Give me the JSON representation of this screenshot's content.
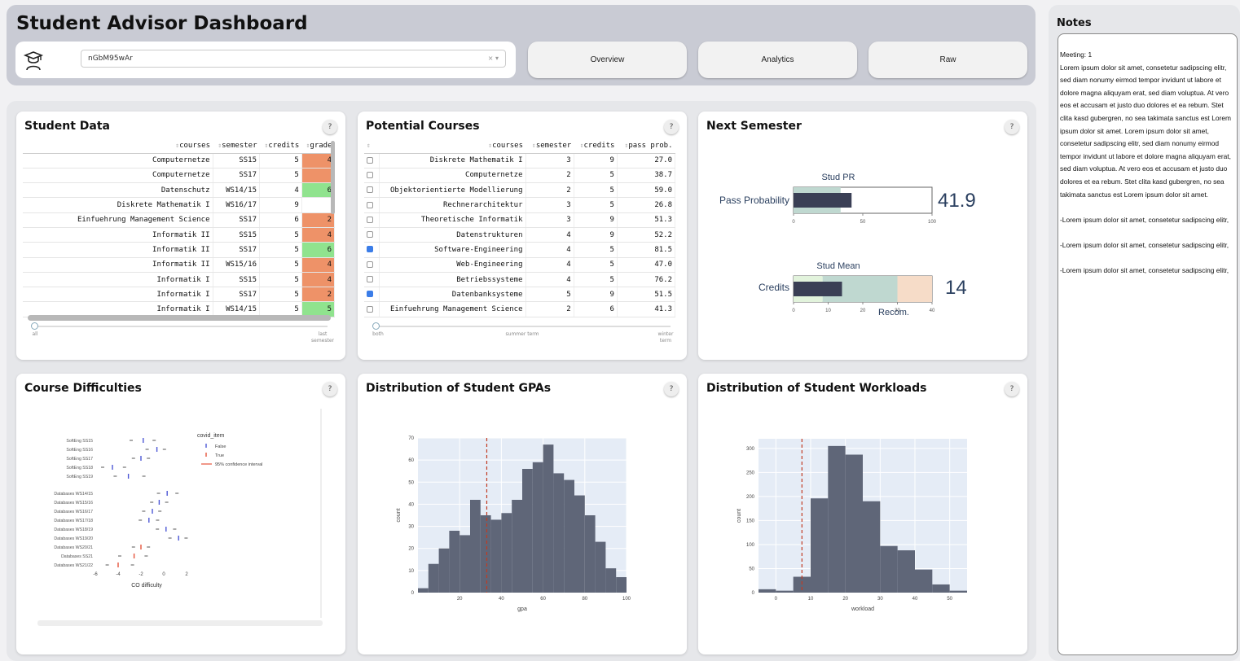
{
  "header": {
    "title": "Student Advisor Dashboard",
    "student_id": "nGbM95wAr",
    "clear_symbol": "×",
    "dropdown_symbol": "▾",
    "nav": [
      "Overview",
      "Analytics",
      "Raw"
    ]
  },
  "help_label": "?",
  "student_data": {
    "title": "Student Data",
    "columns": [
      "courses",
      "semester",
      "credits",
      "grade"
    ],
    "rows": [
      {
        "course": "Computernetze",
        "semester": "SS15",
        "credits": "5",
        "grade": "4",
        "grade_color": "red"
      },
      {
        "course": "Computernetze",
        "semester": "SS17",
        "credits": "5",
        "grade": "",
        "grade_color": "red"
      },
      {
        "course": "Datenschutz",
        "semester": "WS14/15",
        "credits": "4",
        "grade": "6",
        "grade_color": "green"
      },
      {
        "course": "Diskrete Mathematik I",
        "semester": "WS16/17",
        "credits": "9",
        "grade": "",
        "grade_color": "none"
      },
      {
        "course": "Einfuehrung Management Science",
        "semester": "SS17",
        "credits": "6",
        "grade": "2",
        "grade_color": "red"
      },
      {
        "course": "Informatik II",
        "semester": "SS15",
        "credits": "5",
        "grade": "4",
        "grade_color": "red"
      },
      {
        "course": "Informatik II",
        "semester": "SS17",
        "credits": "5",
        "grade": "6",
        "grade_color": "green"
      },
      {
        "course": "Informatik II",
        "semester": "WS15/16",
        "credits": "5",
        "grade": "4",
        "grade_color": "red"
      },
      {
        "course": "Informatik I",
        "semester": "SS15",
        "credits": "5",
        "grade": "4",
        "grade_color": "red"
      },
      {
        "course": "Informatik I",
        "semester": "SS17",
        "credits": "5",
        "grade": "2",
        "grade_color": "red"
      },
      {
        "course": "Informatik I",
        "semester": "WS14/15",
        "credits": "5",
        "grade": "5",
        "grade_color": "green"
      }
    ],
    "slider_labels": {
      "left": "all",
      "right": "last semester"
    }
  },
  "potential_courses": {
    "title": "Potential Courses",
    "columns": [
      "courses",
      "semester",
      "credits",
      "pass prob."
    ],
    "rows": [
      {
        "checked": false,
        "course": "Diskrete Mathematik I",
        "semester": "3",
        "credits": "9",
        "prob": "27.0"
      },
      {
        "checked": false,
        "course": "Computernetze",
        "semester": "2",
        "credits": "5",
        "prob": "38.7"
      },
      {
        "checked": false,
        "course": "Objektorientierte Modellierung",
        "semester": "2",
        "credits": "5",
        "prob": "59.0"
      },
      {
        "checked": false,
        "course": "Rechnerarchitektur",
        "semester": "3",
        "credits": "5",
        "prob": "26.8"
      },
      {
        "checked": false,
        "course": "Theoretische Informatik",
        "semester": "3",
        "credits": "9",
        "prob": "51.3"
      },
      {
        "checked": false,
        "course": "Datenstrukturen",
        "semester": "4",
        "credits": "9",
        "prob": "52.2"
      },
      {
        "checked": true,
        "course": "Software-Engineering",
        "semester": "4",
        "credits": "5",
        "prob": "81.5"
      },
      {
        "checked": false,
        "course": "Web-Engineering",
        "semester": "4",
        "credits": "5",
        "prob": "47.0"
      },
      {
        "checked": false,
        "course": "Betriebssysteme",
        "semester": "4",
        "credits": "5",
        "prob": "76.2"
      },
      {
        "checked": true,
        "course": "Datenbanksysteme",
        "semester": "5",
        "credits": "9",
        "prob": "51.5"
      },
      {
        "checked": false,
        "course": "Einfuehrung Management Science",
        "semester": "2",
        "credits": "6",
        "prob": "41.3"
      }
    ],
    "slider_labels": {
      "left": "both",
      "middle": "summer term",
      "right": "winter term"
    }
  },
  "next_semester": {
    "title": "Next Semester",
    "gauges": [
      {
        "label": "Pass Probability",
        "value_text": "41.9",
        "value": 41.9,
        "reference_label": "Stud PR",
        "range": [
          0,
          100
        ],
        "ticks": [
          "0",
          "50",
          "100"
        ],
        "band": 34,
        "extra_label": ""
      },
      {
        "label": "Credits",
        "value_text": "14",
        "value": 14,
        "reference_label": "Stud Mean",
        "range": [
          0,
          40
        ],
        "ticks": [
          "0",
          "10",
          "20",
          "30",
          "40"
        ],
        "band": 30,
        "extra_label": "Recom."
      }
    ]
  },
  "colors": {
    "red": "#ee9268",
    "green": "#90e38e",
    "bar": "#5f6678",
    "plot_bg": "#e5ecf6",
    "vline": "#c23b22",
    "gauge_bar": "#3a3f55",
    "gauge_band": "#bfd8d0",
    "gauge_peach": "#f6dcc8",
    "gauge_light": "#e2f3dc"
  },
  "charts": {
    "difficulties": {
      "title": "Course Difficulties"
    },
    "gpa": {
      "title": "Distribution of Student GPAs"
    },
    "workload": {
      "title": "Distribution of Student Workloads"
    }
  },
  "notes": {
    "title": "Notes",
    "text": "Meeting: 1\nLorem ipsum dolor sit amet, consetetur sadipscing elitr, sed diam nonumy eirmod tempor invidunt ut labore et dolore magna aliquyam erat, sed diam voluptua. At vero eos et accusam et justo duo dolores et ea rebum. Stet clita kasd gubergren, no sea takimata sanctus est Lorem ipsum dolor sit amet. Lorem ipsum dolor sit amet, consetetur sadipscing elitr, sed diam nonumy eirmod tempor invidunt ut labore et dolore magna aliquyam erat, sed diam voluptua. At vero eos et accusam et justo duo dolores et ea rebum. Stet clita kasd gubergren, no sea takimata sanctus est Lorem ipsum dolor sit amet.\n\n-Lorem ipsum dolor sit amet, consetetur sadipscing elitr,\n\n-Lorem ipsum dolor sit amet, consetetur sadipscing elitr,\n\n-Lorem ipsum dolor sit amet, consetetur sadipscing elitr,"
  },
  "chart_data": [
    {
      "type": "scatter",
      "title": "Course Difficulties",
      "xlabel": "CO difficulty",
      "ylabel": "",
      "xlim": [
        -6,
        3
      ],
      "x_ticks": [
        "-6",
        "-4",
        "-2",
        "0",
        "2"
      ],
      "legend": {
        "title": "covid_item",
        "entries": [
          "False",
          "True",
          "95% confidence interval"
        ],
        "placement": "right"
      },
      "categories": [
        "SoftEng SS15",
        "SoftEng SS16",
        "SoftEng SS17",
        "SoftEng SS18",
        "SoftEng SS19",
        "Databases WS14/15",
        "Databases WS15/16",
        "Databases WS16/17",
        "Databases WS17/18",
        "Databases WS18/19",
        "Databases WS19/20",
        "Databases WS20/21",
        "Databases SS21",
        "Databases WS21/22"
      ],
      "points": [
        {
          "cat": "SoftEng SS15",
          "x": -1.8,
          "lo": -3.0,
          "hi": -0.7,
          "covid": false
        },
        {
          "cat": "SoftEng SS16",
          "x": -0.6,
          "lo": -1.6,
          "hi": 0.2,
          "covid": false
        },
        {
          "cat": "SoftEng SS17",
          "x": -2.0,
          "lo": -2.8,
          "hi": -1.2,
          "covid": false
        },
        {
          "cat": "SoftEng SS18",
          "x": -4.5,
          "lo": -5.5,
          "hi": -3.3,
          "covid": false
        },
        {
          "cat": "SoftEng SS19",
          "x": -3.1,
          "lo": -4.4,
          "hi": -1.6,
          "covid": false
        },
        {
          "cat": "Databases WS14/15",
          "x": 0.3,
          "lo": -0.6,
          "hi": 1.3,
          "covid": false
        },
        {
          "cat": "Databases WS15/16",
          "x": -0.4,
          "lo": -1.2,
          "hi": 0.4,
          "covid": false
        },
        {
          "cat": "Databases WS16/17",
          "x": -1.0,
          "lo": -1.9,
          "hi": -0.2,
          "covid": false
        },
        {
          "cat": "Databases WS17/18",
          "x": -1.3,
          "lo": -2.2,
          "hi": -0.4,
          "covid": false
        },
        {
          "cat": "Databases WS18/19",
          "x": 0.2,
          "lo": -0.7,
          "hi": 1.1,
          "covid": false
        },
        {
          "cat": "Databases WS19/20",
          "x": 1.3,
          "lo": 0.4,
          "hi": 2.1,
          "covid": false
        },
        {
          "cat": "Databases WS20/21",
          "x": -2.0,
          "lo": -2.8,
          "hi": -1.2,
          "covid": true
        },
        {
          "cat": "Databases SS21",
          "x": -2.6,
          "lo": -4.0,
          "hi": -1.4,
          "covid": true
        },
        {
          "cat": "Databases WS21/22",
          "x": -4.0,
          "lo": -5.1,
          "hi": -2.6,
          "covid": true
        }
      ]
    },
    {
      "type": "bar",
      "title": "Distribution of Student GPAs",
      "xlabel": "gpa",
      "ylabel": "count",
      "xlim": [
        0,
        100
      ],
      "ylim": [
        0,
        70
      ],
      "x_ticks": [
        "20",
        "40",
        "60",
        "80",
        "100"
      ],
      "y_ticks": [
        "0",
        "10",
        "20",
        "30",
        "40",
        "50",
        "60",
        "70"
      ],
      "bins_start": 0,
      "bin_width": 5,
      "values": [
        2,
        13,
        20,
        28,
        26,
        42,
        35,
        33,
        36,
        42,
        56,
        59,
        67,
        54,
        51,
        44,
        35,
        23,
        11,
        7
      ],
      "marker_x": 33
    },
    {
      "type": "bar",
      "title": "Distribution of Student Workloads",
      "xlabel": "workload",
      "ylabel": "count",
      "xlim": [
        -5,
        55
      ],
      "ylim": [
        0,
        320
      ],
      "x_ticks": [
        "0",
        "10",
        "20",
        "30",
        "40",
        "50"
      ],
      "y_ticks": [
        "0",
        "50",
        "100",
        "150",
        "200",
        "250",
        "300"
      ],
      "bins_start": -5,
      "bin_width": 5,
      "values": [
        7,
        4,
        33,
        196,
        305,
        287,
        190,
        97,
        88,
        48,
        17,
        4
      ],
      "marker_x": 7.5
    }
  ]
}
